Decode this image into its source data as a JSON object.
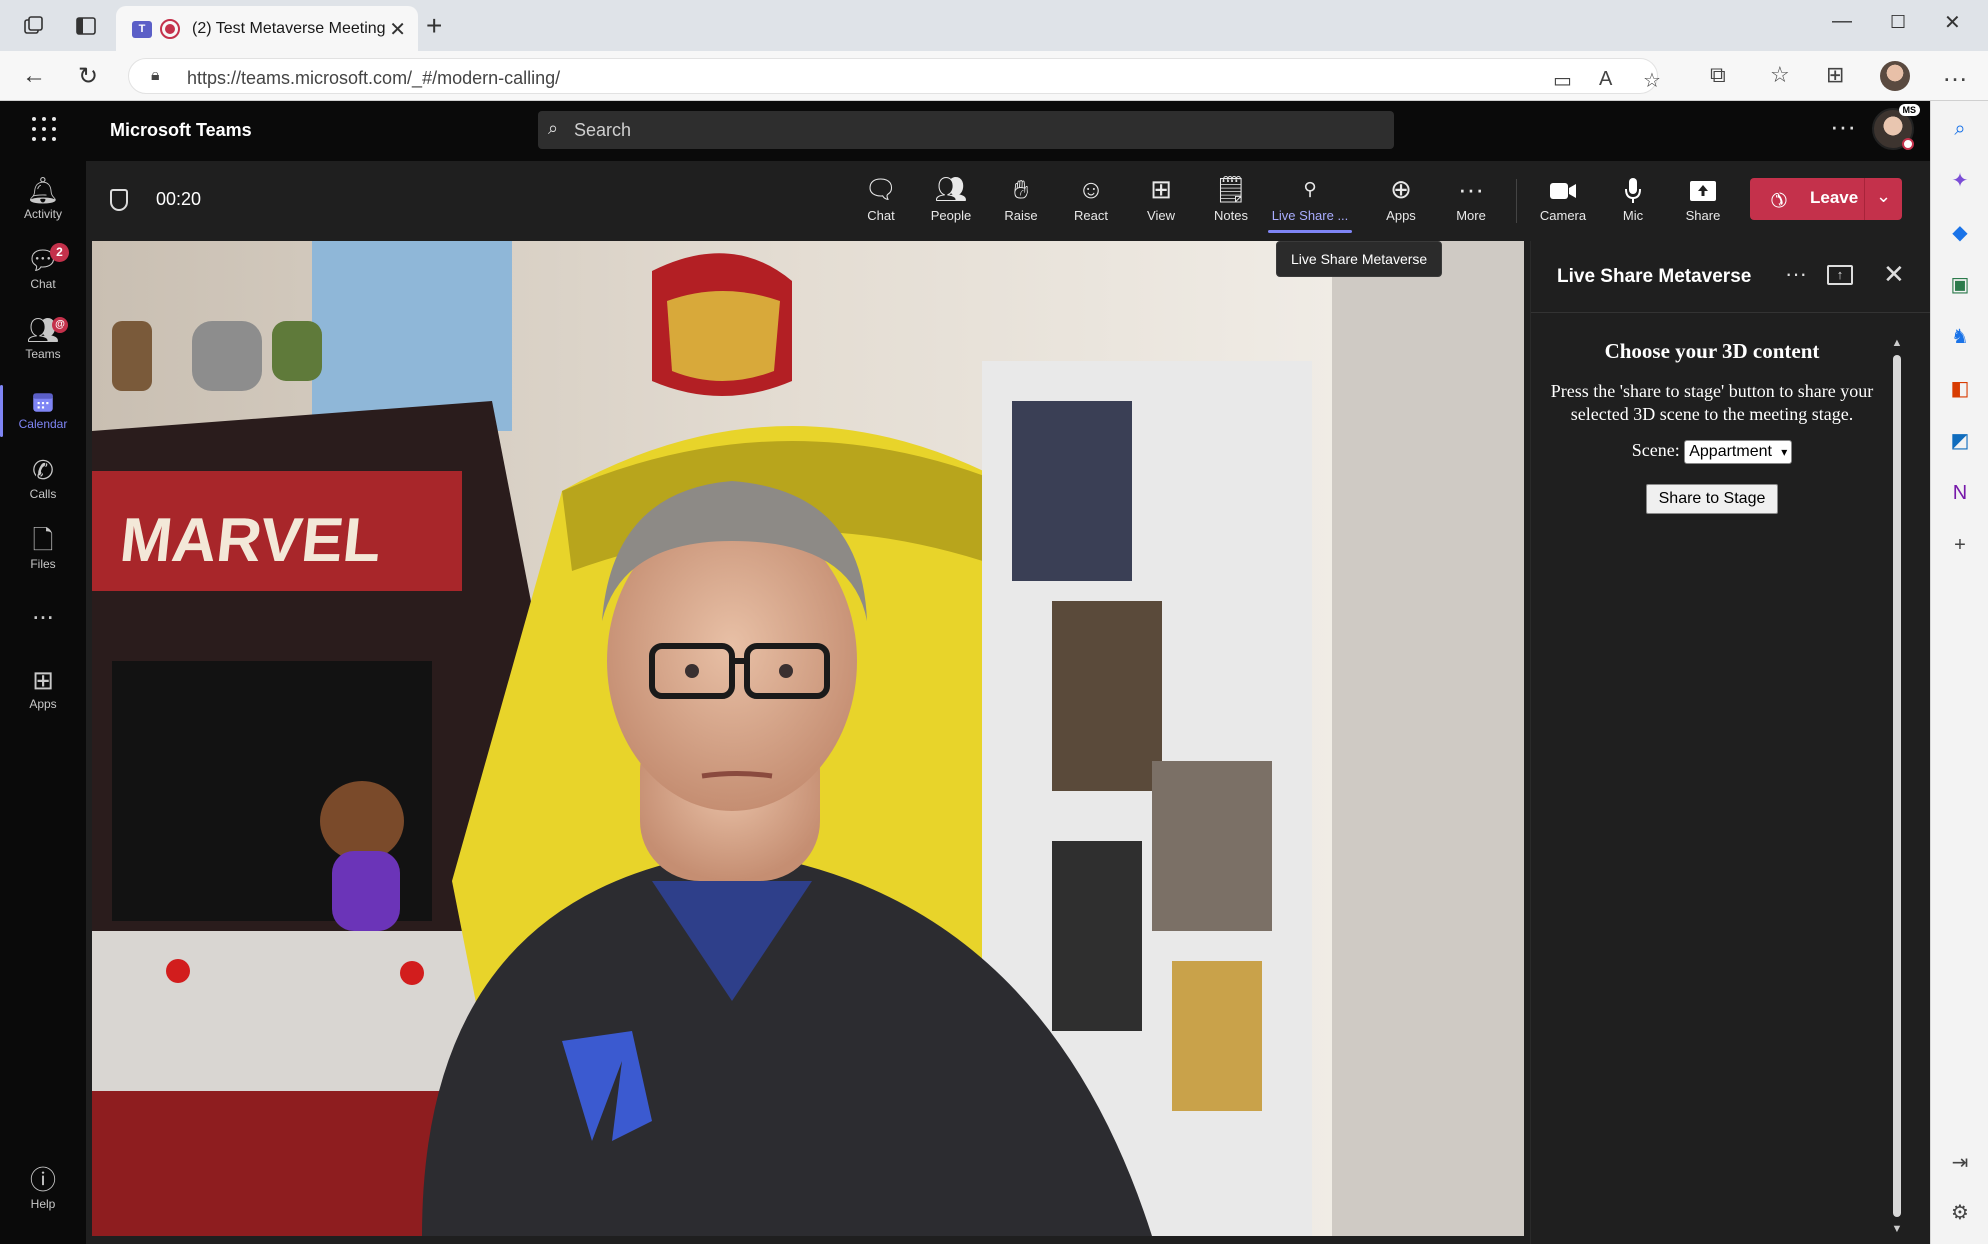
{
  "browser": {
    "tab_title": "(2) Test Metaverse Meeting",
    "url": "https://teams.microsoft.com/_#/modern-calling/"
  },
  "teams": {
    "app_name": "Microsoft Teams",
    "search_placeholder": "Search",
    "rail": [
      {
        "label": "Activity",
        "icon": "bell-icon"
      },
      {
        "label": "Chat",
        "icon": "chat-icon",
        "badge": "2"
      },
      {
        "label": "Teams",
        "icon": "teams-icon",
        "badge": "@"
      },
      {
        "label": "Calendar",
        "icon": "calendar-icon",
        "active": true
      },
      {
        "label": "Calls",
        "icon": "phone-icon"
      },
      {
        "label": "Files",
        "icon": "file-icon"
      },
      {
        "label": "...",
        "icon": "more-icon"
      },
      {
        "label": "Apps",
        "icon": "apps-icon"
      },
      {
        "label": "Help",
        "icon": "help-icon"
      }
    ],
    "meeting": {
      "timer": "00:20",
      "toolbar": [
        {
          "label": "Chat",
          "icon": "chat-bubble-icon"
        },
        {
          "label": "People",
          "icon": "people-icon"
        },
        {
          "label": "Raise",
          "icon": "hand-icon"
        },
        {
          "label": "React",
          "icon": "smiley-icon"
        },
        {
          "label": "View",
          "icon": "grid-icon"
        },
        {
          "label": "Notes",
          "icon": "notes-icon"
        },
        {
          "label": "Live Share ...",
          "icon": "live-share-icon",
          "active": true
        },
        {
          "label": "Apps",
          "icon": "add-app-icon"
        },
        {
          "label": "More",
          "icon": "ellipsis-icon"
        },
        {
          "label": "Camera",
          "icon": "camera-icon"
        },
        {
          "label": "Mic",
          "icon": "mic-icon"
        },
        {
          "label": "Share",
          "icon": "share-screen-icon"
        }
      ],
      "leave_label": "Leave",
      "tooltip": "Live Share Metaverse"
    },
    "panel": {
      "title": "Live Share Metaverse",
      "heading": "Choose your 3D content",
      "description": "Press the 'share to stage' button to share your selected 3D scene to the meeting stage.",
      "scene_label": "Scene:",
      "scene_value": "Appartment",
      "share_button": "Share to Stage"
    }
  },
  "colors": {
    "accent": "#7f85f5",
    "leave": "#c4314b",
    "badge": "#c4314b"
  }
}
